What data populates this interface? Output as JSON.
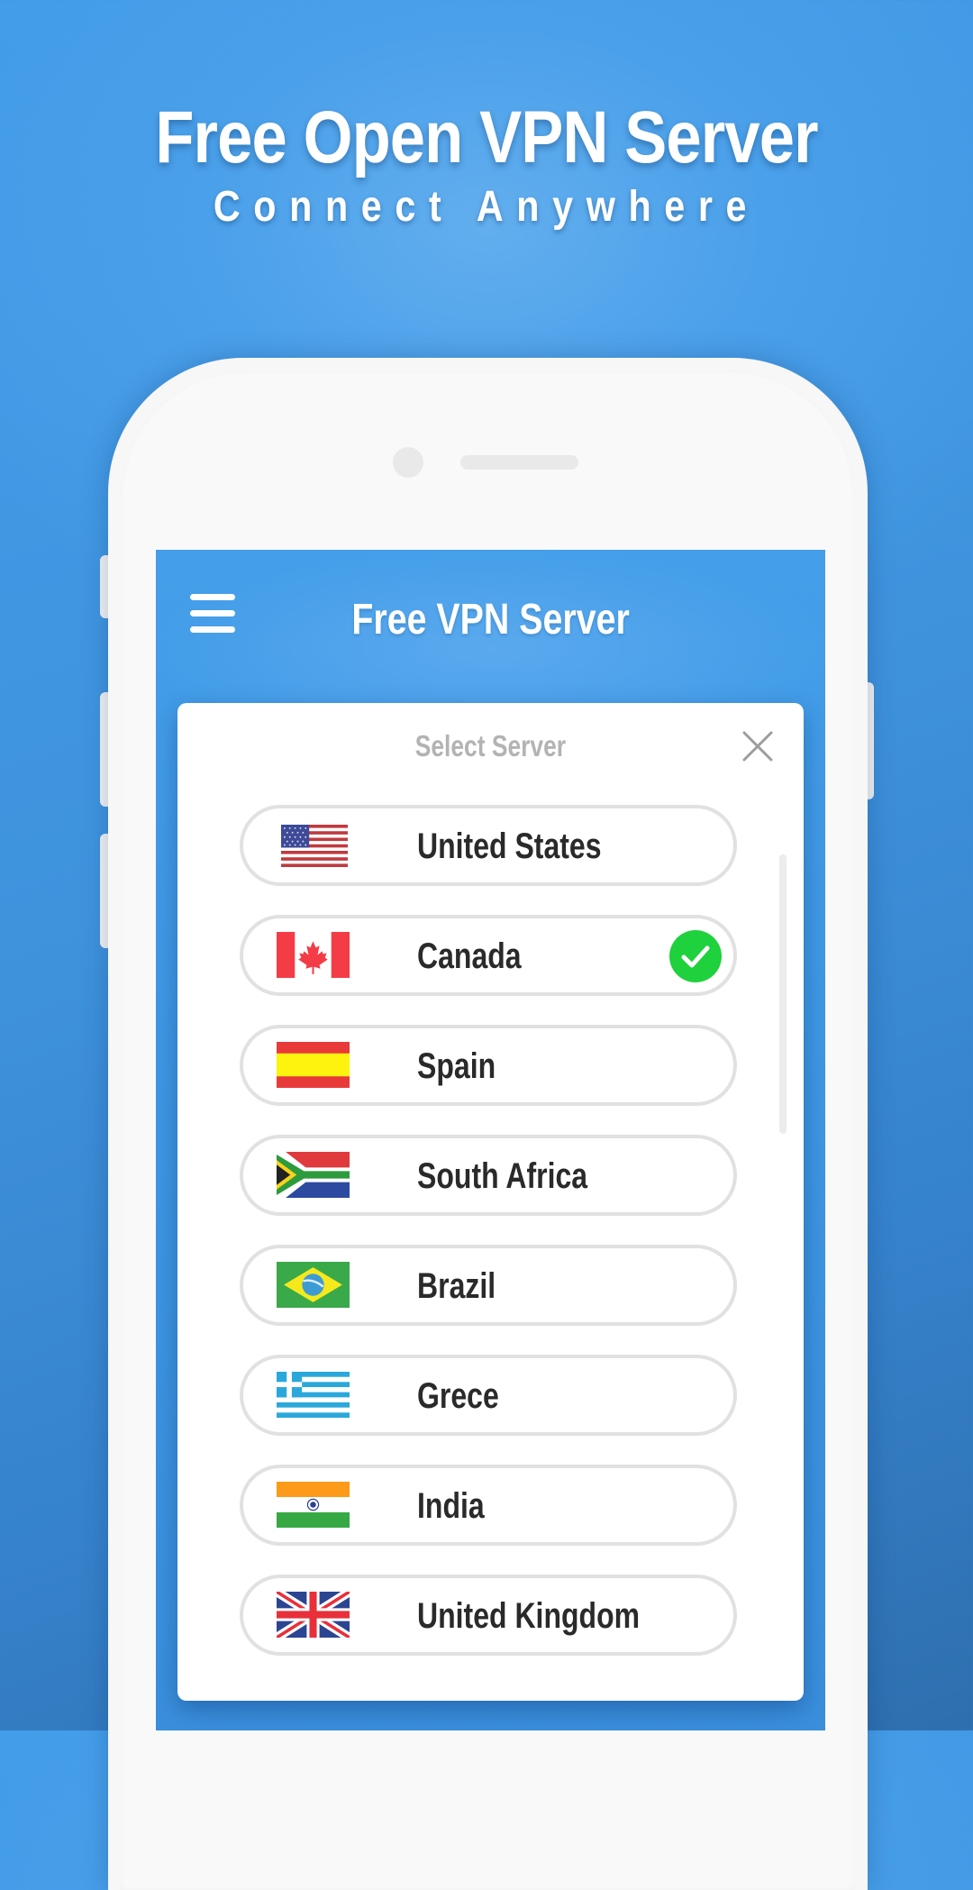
{
  "promo": {
    "headline": "Free Open VPN Server",
    "subline": "Connect Anywhere"
  },
  "app": {
    "title": "Free VPN Server",
    "menu_icon": "hamburger-menu-icon",
    "accent_color": "#3f98e4"
  },
  "dialog": {
    "title": "Select Server",
    "close_icon": "close-icon",
    "selected_country": "Canada",
    "selected_indicator_color": "#1fd13c",
    "servers": [
      {
        "country": "United States",
        "flag": "us-flag-icon",
        "selected": false
      },
      {
        "country": "Canada",
        "flag": "canada-flag-icon",
        "selected": true
      },
      {
        "country": "Spain",
        "flag": "spain-flag-icon",
        "selected": false
      },
      {
        "country": "South Africa",
        "flag": "south-africa-flag-icon",
        "selected": false
      },
      {
        "country": "Brazil",
        "flag": "brazil-flag-icon",
        "selected": false
      },
      {
        "country": "Grece",
        "flag": "greece-flag-icon",
        "selected": false
      },
      {
        "country": "India",
        "flag": "india-flag-icon",
        "selected": false
      },
      {
        "country": "United Kingdom",
        "flag": "uk-flag-icon",
        "selected": false
      }
    ]
  }
}
